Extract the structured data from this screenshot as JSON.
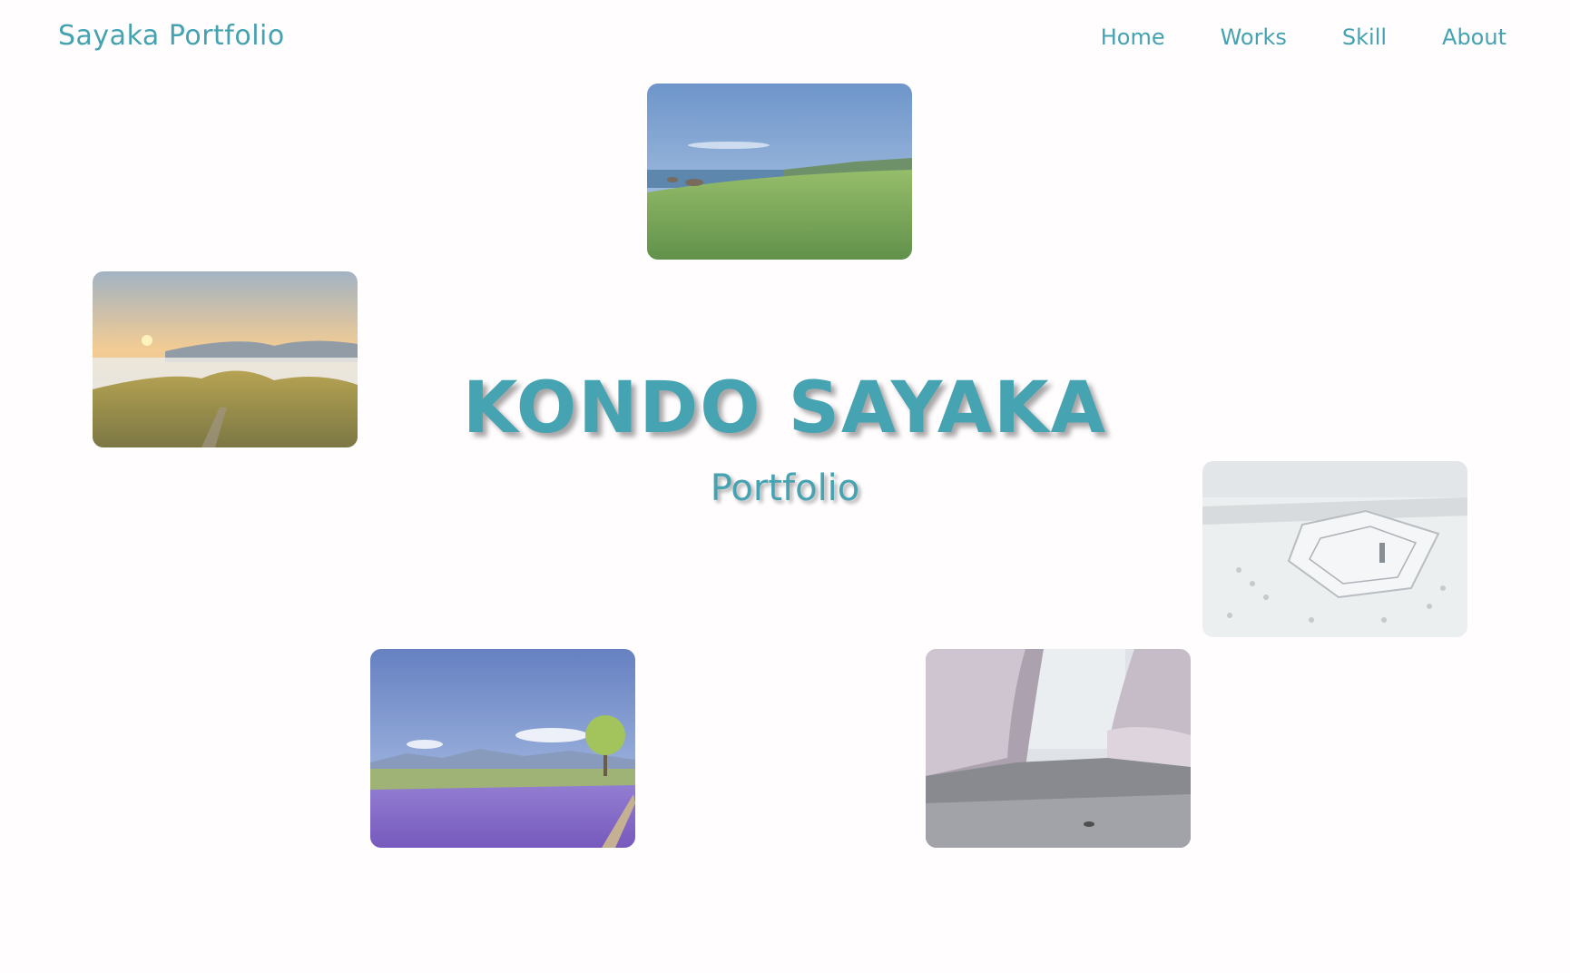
{
  "header": {
    "brand": "Sayaka Portfolio",
    "nav": [
      "Home",
      "Works",
      "Skill",
      "About"
    ]
  },
  "hero": {
    "title": "KONDO SAYAKA",
    "subtitle": "Portfolio"
  },
  "colors": {
    "accent": "#45a2b1",
    "background": "#fffdfd"
  },
  "photos": [
    {
      "name": "coastal-grassland-photo"
    },
    {
      "name": "sunrise-mountain-photo"
    },
    {
      "name": "snowy-fort-photo"
    },
    {
      "name": "lavender-field-photo"
    },
    {
      "name": "cherry-blossom-moat-photo"
    }
  ]
}
